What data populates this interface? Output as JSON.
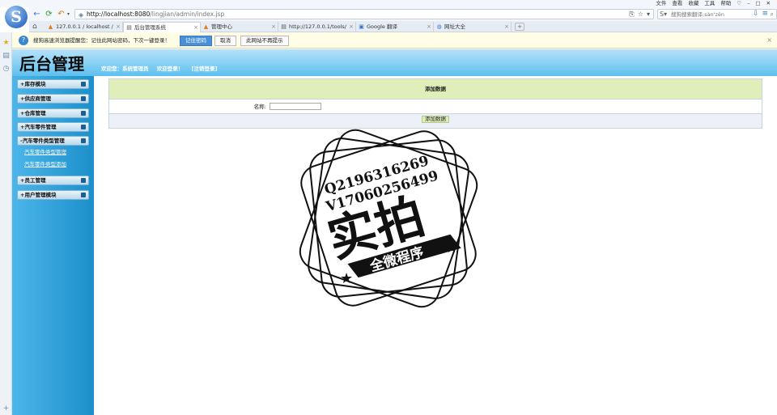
{
  "browser": {
    "top_menu": [
      "文件",
      "查看",
      "收藏",
      "工具",
      "帮助"
    ],
    "logo_letter": "S",
    "address_host": "http://localhost:8080",
    "address_path": "/lingjian/admin/index.jsp",
    "search_placeholder": "搜狗搜索翻译:sàn'zěn",
    "tabs": [
      {
        "label": "127.0.0.1 / localhost /",
        "icon": "phpmyadmin-icon"
      },
      {
        "label": "后台管理系统",
        "icon": "page-icon",
        "active": true
      },
      {
        "label": "管理中心",
        "icon": "phpmyadmin-icon"
      },
      {
        "label": "http://127.0.0.1/tools/",
        "icon": "page-icon"
      },
      {
        "label": "Google 翻译",
        "icon": "google-icon"
      },
      {
        "label": "网址大全",
        "icon": "globe-icon"
      }
    ],
    "new_tab": "+"
  },
  "infobar": {
    "text": "搜狗高速浏览器提醒您：记住此网站密码，下次一键登录！",
    "remember_label": "记住密码",
    "cancel_label": "取消",
    "never_label": "此网站不再提示"
  },
  "header": {
    "title": "后台管理",
    "welcome_user": "欢迎您：系统管理员",
    "welcome_login": "欢迎登录！",
    "logout": "[注销登录]"
  },
  "nav": {
    "items": [
      {
        "label": "+库存模块"
      },
      {
        "label": "+供应商管理"
      },
      {
        "label": "+仓库管理"
      },
      {
        "label": "+汽车零件管理"
      },
      {
        "label": "+汽车零件类型管理"
      },
      {
        "label": "-汽车零件类型管理"
      },
      {
        "label": "+员工管理"
      },
      {
        "label": "+用户管理模块"
      }
    ],
    "sub_links": [
      "汽车零件类型管理",
      "汽车零件类型添加"
    ]
  },
  "form": {
    "header": "添加数据",
    "name_label": "名称:",
    "name_value": "",
    "submit_label": "添加数据"
  },
  "watermark": {
    "line1": "Q2196316269",
    "line2": "V17060256499",
    "big": "实拍",
    "banner": "全微程序"
  }
}
